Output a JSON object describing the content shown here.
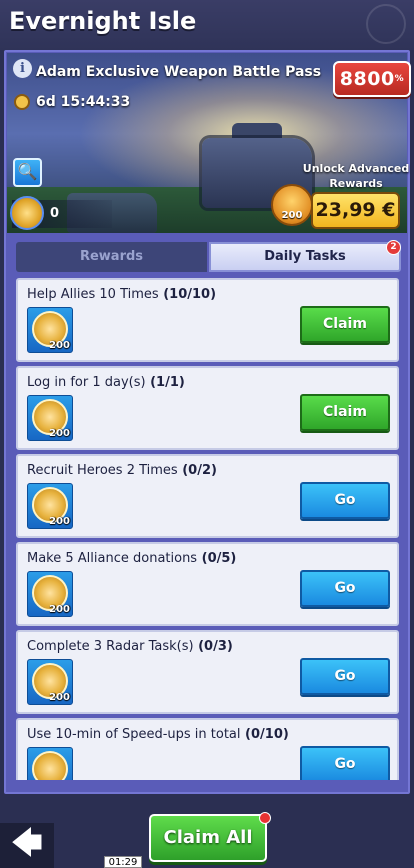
{
  "header": {
    "title": "Evernight Isle"
  },
  "banner": {
    "info_glyph": "i",
    "pass_name": "Adam Exclusive Weapon Battle Pass",
    "timer": "6d 15:44:33",
    "price_value": "8800",
    "price_suffix": "%",
    "unlock_label": "Unlock Advanced Rewards",
    "token_count": "0",
    "buy_icon_qty": "200",
    "buy_price": "23,99 €",
    "search_glyph": "🔍"
  },
  "tabs": {
    "rewards_label": "Rewards",
    "daily_label": "Daily Tasks",
    "daily_badge": "2"
  },
  "tasks": [
    {
      "title": "Help Allies 10 Times",
      "progress": "(10/10)",
      "reward_qty": "200",
      "button": "Claim",
      "state": "claim"
    },
    {
      "title": "Log in for 1 day(s)",
      "progress": "(1/1)",
      "reward_qty": "200",
      "button": "Claim",
      "state": "claim"
    },
    {
      "title": "Recruit Heroes 2 Times",
      "progress": "(0/2)",
      "reward_qty": "200",
      "button": "Go",
      "state": "go"
    },
    {
      "title": "Make 5 Alliance donations",
      "progress": "(0/5)",
      "reward_qty": "200",
      "button": "Go",
      "state": "go"
    },
    {
      "title": "Complete 3 Radar Task(s)",
      "progress": "(0/3)",
      "reward_qty": "200",
      "button": "Go",
      "state": "go"
    },
    {
      "title": "Use 10-min of Speed-ups in total",
      "progress": "(0/10)",
      "reward_qty": "200",
      "button": "Go",
      "state": "go"
    }
  ],
  "footer": {
    "back_glyph": "🡄",
    "claim_all_label": "Claim All",
    "time_tag": "01:29"
  },
  "colors": {
    "claim_green": "#2fa62a",
    "go_blue": "#1a8ae0",
    "price_red": "#d03a32",
    "frame_purple": "#5a5cb8"
  }
}
